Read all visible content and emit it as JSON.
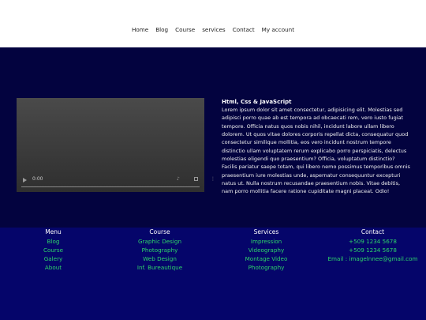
{
  "nav": {
    "items": [
      "Home",
      "Blog",
      "Course",
      "services",
      "Contact",
      "My account"
    ]
  },
  "video": {
    "time": "0:00"
  },
  "article": {
    "title": "Html, Css & JavaScript",
    "body": "Lorem ipsum dolor sit amet consectetur, adipisicing elit. Molestias sed adipisci porro quae ab est tempora ad obcaecati rem, vero iusto fugiat tempore. Officia natus quos nobis nihil, incidunt labore ullam libero dolorem. Ut quos vitae dolores corporis repellat dicta, consequatur quod consectetur similique mollitia, eos vero incidunt nostrum tempore distinctio ullam voluptatem rerum explicabo porro perspiciatis, delectus molestias eligendi quo praesentium? Officia, voluptatum distinctio? Facilis pariatur saepe totam, qui libero nemo possimus temporibus omnis praesentium iure molestias unde, aspernatur consequuntur excepturi natus ut. Nulla nostrum recusandae praesentium nobis. Vitae debitis, nam porro mollitia facere ratione cupiditate magni placeat. Odio!"
  },
  "footer": {
    "columns": [
      {
        "heading": "Menu",
        "items": [
          "Blog",
          "Course",
          "Galery",
          "About"
        ]
      },
      {
        "heading": "Course",
        "items": [
          "Graphic Design",
          "Photography",
          "Web Design",
          "Inf. Bureautique"
        ]
      },
      {
        "heading": "Services",
        "items": [
          "Impression",
          "Videography",
          "Montage Video",
          "Photography"
        ]
      },
      {
        "heading": "Contact",
        "items": [
          "+509 1234 5678",
          "+509 1234 5678",
          "Email : imagelnnee@gmail.com"
        ]
      }
    ]
  },
  "colors": {
    "hero_bg": "#03033f",
    "footer_bg": "#05056a",
    "link_green": "#2ed36a"
  }
}
